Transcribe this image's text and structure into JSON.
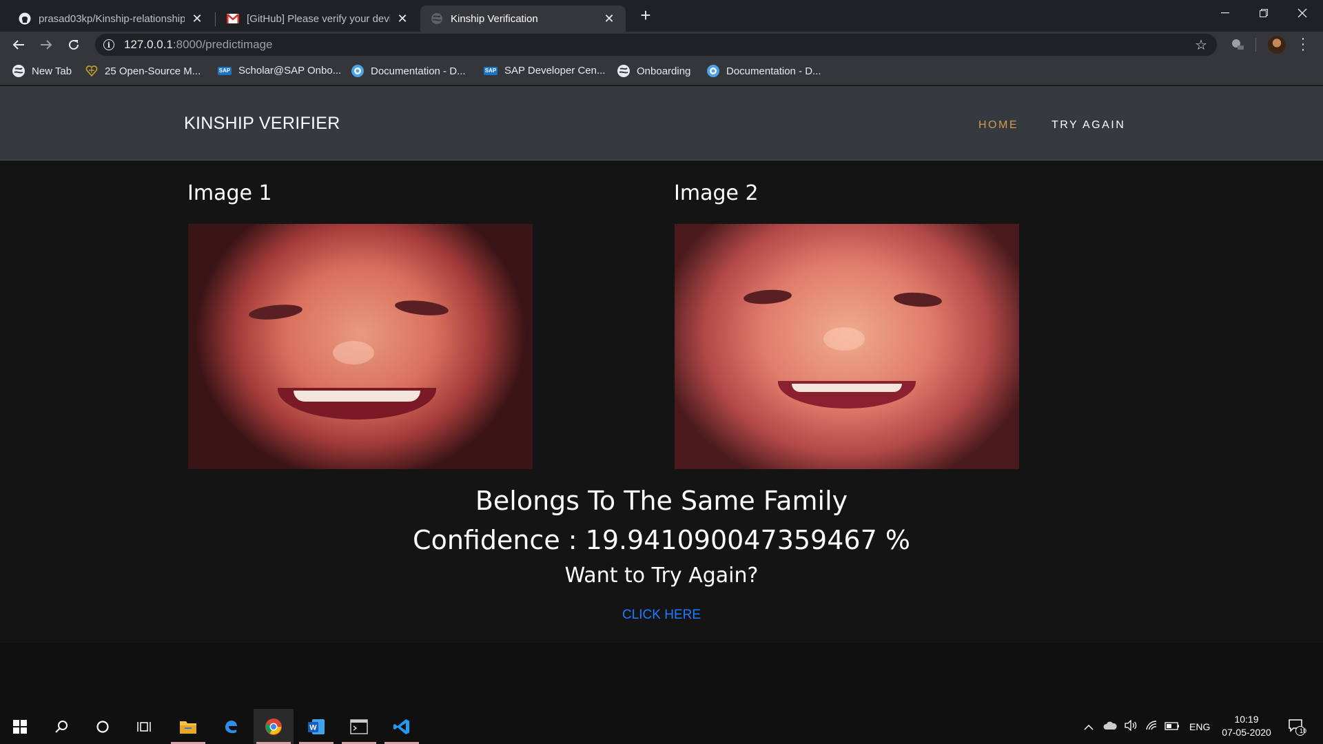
{
  "browser": {
    "tabs": [
      {
        "title": "prasad03kp/Kinship-relationship",
        "icon": "github-icon",
        "active": false
      },
      {
        "title": "[GitHub] Please verify your device",
        "icon": "gmail-icon",
        "active": false
      },
      {
        "title": "Kinship Verification",
        "icon": "globe-icon",
        "active": true
      }
    ],
    "url_host": "127.0.0.1",
    "url_path": ":8000/predictimage",
    "bookmarks": [
      {
        "label": "New Tab",
        "icon": "globe-icon"
      },
      {
        "label": "25 Open-Source M...",
        "icon": "heart-icon"
      },
      {
        "label": "Scholar@SAP Onbo...",
        "icon": "sap-icon"
      },
      {
        "label": "Documentation - D...",
        "icon": "doc-globe-icon"
      },
      {
        "label": "SAP Developer Cen...",
        "icon": "sap-icon"
      },
      {
        "label": "Onboarding",
        "icon": "globe-icon"
      },
      {
        "label": "Documentation - D...",
        "icon": "doc-globe-icon"
      }
    ]
  },
  "site": {
    "brand": "KINSHIP VERIFIER",
    "nav": {
      "home": "HOME",
      "try_again": "TRY AGAIN"
    },
    "accent_color": "#d39a4a",
    "link_color": "#1e7bff"
  },
  "main": {
    "image1_label": "Image 1",
    "image2_label": "Image 2",
    "result_text": "Belongs To The Same Family",
    "confidence_text": "Confidence : 19.941090047359467 %",
    "prompt_text": "Want to Try Again?",
    "click_link": "CLICK HERE"
  },
  "taskbar": {
    "apps": [
      "windows-start-icon",
      "search-icon",
      "cortana-icon",
      "task-view-icon",
      "file-explorer-icon",
      "edge-icon",
      "chrome-icon",
      "word-icon",
      "terminal-icon",
      "vscode-icon"
    ],
    "language": "ENG",
    "time": "10:19",
    "date": "07-05-2020",
    "notification_count": "10"
  }
}
